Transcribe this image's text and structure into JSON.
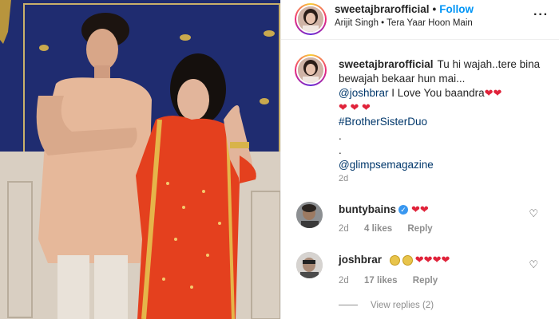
{
  "post": {
    "username": "sweetajbrarofficial",
    "follow_label": "Follow",
    "separator": "•",
    "audio": "Arijit Singh • Tera Yaar Hoon Main",
    "more_label": "···"
  },
  "caption": {
    "username": "sweetajbrarofficial",
    "line1": "Tu hi wajah..tere bina bewajah bekaar hun mai...",
    "mention1": "@joshbrar",
    "text2": " I Love You baandra",
    "hashtag": "#BrotherSisterDuo",
    "dot1": ".",
    "dot2": ".",
    "mention2": "@glimpsemagazine",
    "time": "2d"
  },
  "comments": [
    {
      "username": "buntybains",
      "verified": true,
      "text": "❤❤",
      "time": "2d",
      "likes": "4 likes",
      "reply": "Reply"
    },
    {
      "username": "joshbrar",
      "verified": false,
      "text": "❤❤❤❤",
      "time": "2d",
      "likes": "17 likes",
      "reply": "Reply"
    }
  ],
  "view_replies": "View replies (2)",
  "icons": {
    "heart_outline": "♡",
    "heart_red": "❤",
    "verified": "✓"
  },
  "colors": {
    "link_blue": "#0095f6",
    "mention": "#00376b",
    "heart": "#e0233a",
    "secondary_text": "#8e8e8e"
  }
}
